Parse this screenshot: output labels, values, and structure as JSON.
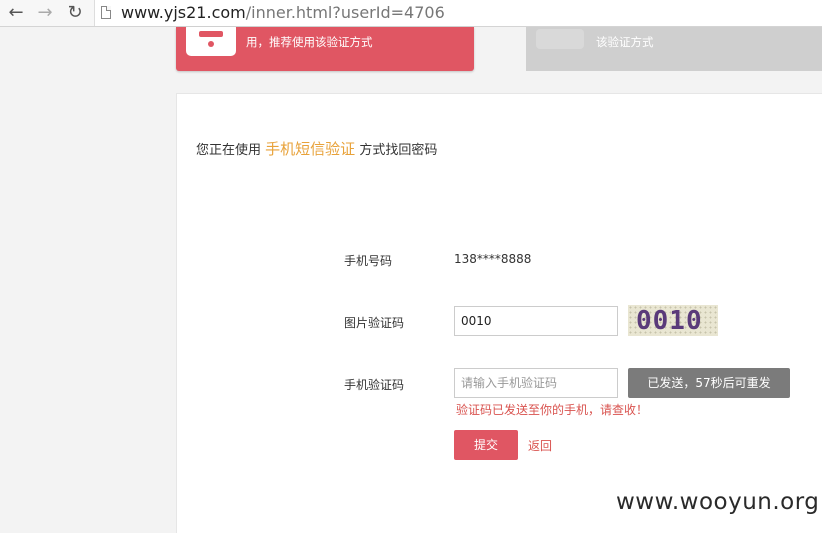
{
  "browser": {
    "url_main": "www.yjs21.com",
    "url_path": "/inner.html?userId=4706"
  },
  "cards": {
    "sms_card_text": "用，推荐使用该验证方式",
    "other_card_text": "该验证方式"
  },
  "intro": {
    "prefix": "您正在使用",
    "method": "手机短信验证",
    "suffix": "方式找回密码"
  },
  "form": {
    "phone_label": "手机号码",
    "phone_value": "138****8888",
    "image_code_label": "图片验证码",
    "image_code_value": "0010",
    "captcha_text": "0010",
    "sms_code_label": "手机验证码",
    "sms_code_placeholder": "请输入手机验证码",
    "send_button": "已发送，57秒后可重发",
    "notice": "验证码已发送至你的手机，请查收！",
    "submit": "提交",
    "back": "返回"
  },
  "watermark": "www.wooyun.org",
  "colors": {
    "accent": "#e05663",
    "method": "#e8a23a",
    "error": "#d9534f"
  },
  "icons": [
    "back-arrow-icon",
    "forward-arrow-icon",
    "reload-icon",
    "page-icon",
    "phone-icon"
  ]
}
